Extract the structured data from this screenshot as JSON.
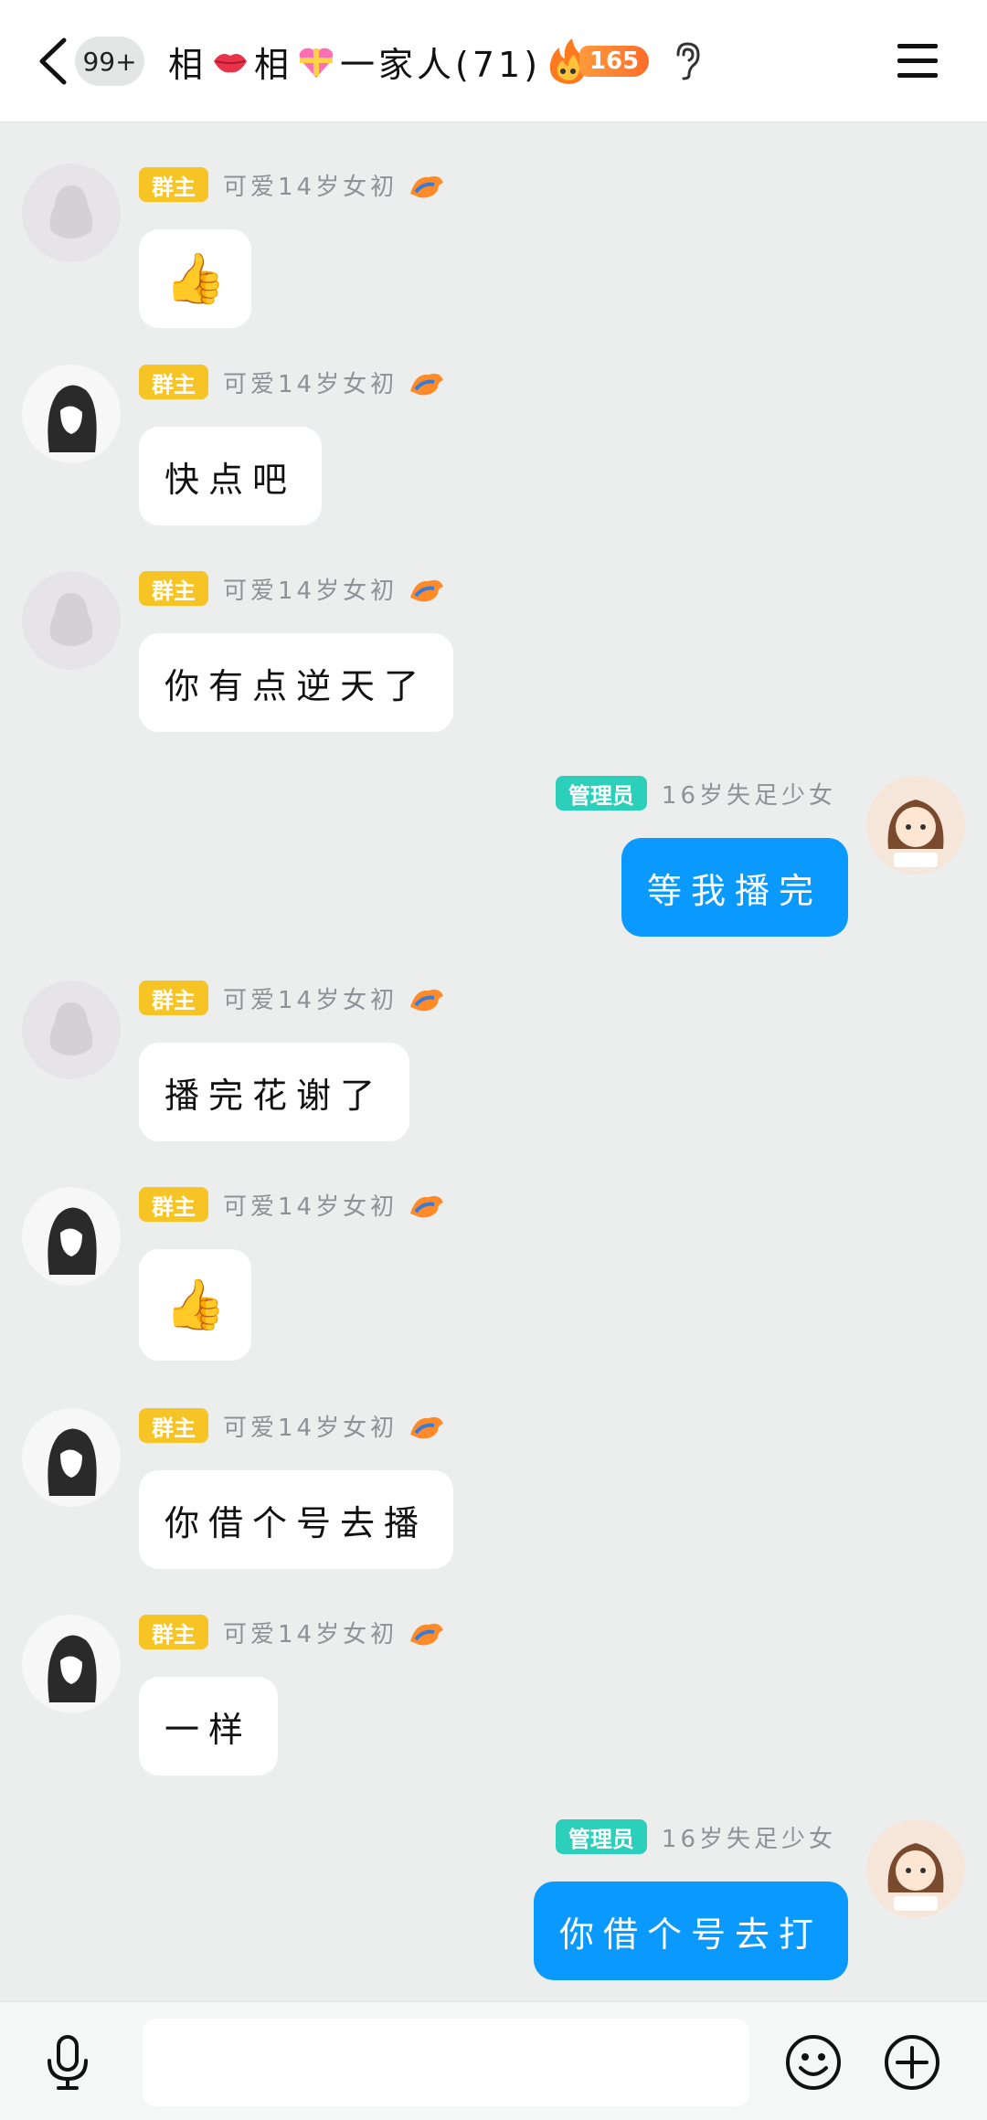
{
  "header": {
    "unread_count": "99+",
    "title_part1": "相",
    "title_part2": "相",
    "title_part3": "一家人(71)",
    "fire_count": "165"
  },
  "messages": [
    {
      "side": "left",
      "role": "群主",
      "nickname": "可爱14岁女初",
      "avatar": "default-penguin",
      "text": "👍",
      "is_emoji": true
    },
    {
      "side": "left",
      "role": "群主",
      "nickname": "可爱14岁女初",
      "avatar": "anime-girl",
      "text": "快点吧"
    },
    {
      "side": "left",
      "role": "群主",
      "nickname": "可爱14岁女初",
      "avatar": "default-penguin",
      "text": "你有点逆天了"
    },
    {
      "side": "right",
      "role": "管理员",
      "nickname": "16岁失足少女",
      "avatar": "cartoon-girl",
      "text": "等我播完"
    },
    {
      "side": "left",
      "role": "群主",
      "nickname": "可爱14岁女初",
      "avatar": "default-penguin",
      "text": "播完花谢了"
    },
    {
      "side": "left",
      "role": "群主",
      "nickname": "可爱14岁女初",
      "avatar": "anime-girl",
      "text": "👍",
      "is_emoji": true
    },
    {
      "side": "left",
      "role": "群主",
      "nickname": "可爱14岁女初",
      "avatar": "anime-girl",
      "text": "你借个号去播"
    },
    {
      "side": "left",
      "role": "群主",
      "nickname": "可爱14岁女初",
      "avatar": "anime-girl",
      "text": "一样"
    },
    {
      "side": "right",
      "role": "管理员",
      "nickname": "16岁失足少女",
      "avatar": "cartoon-girl",
      "text": "你借个号去打"
    }
  ],
  "input": {
    "placeholder": ""
  },
  "colors": {
    "owner_tag": "#f7c425",
    "admin_tag": "#2ccfb9",
    "self_bubble": "#0a99ff",
    "chat_bg": "#eceeee"
  },
  "icons": {
    "back": "chevron-left-icon",
    "ear": "ear-icon",
    "menu": "hamburger-menu-icon",
    "mic": "microphone-icon",
    "emoji": "smiley-icon",
    "plus": "plus-circle-icon"
  }
}
